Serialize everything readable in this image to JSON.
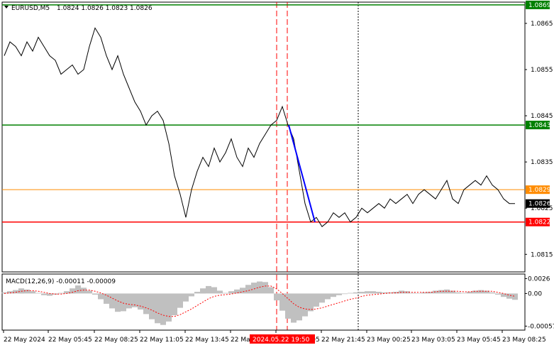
{
  "header": {
    "symbol": "EURUSD,M5",
    "ohlc": "1.0824 1.0826 1.0823 1.0826"
  },
  "colors": {
    "background": "#ffffff",
    "frame": "#000000",
    "price_line": "#000000",
    "green_line": "#008000",
    "orange_line": "#ff8c00",
    "red_line": "#ff0000",
    "trend_line": "#0000ff",
    "macd_hist": "#c0c0c0",
    "signal_line": "#ff0000",
    "vline_red": "#ff0000",
    "vline_black": "#000000",
    "current_price_bg": "#000000",
    "time_highlight_bg": "#ff0000"
  },
  "chart_data": [
    {
      "type": "line",
      "title": "EURUSD,M5",
      "y_ticks": [
        "1.0865",
        "1.0855",
        "1.0845",
        "1.0835",
        "1.0825",
        "1.0815"
      ],
      "ylim": [
        1.08112,
        1.08696
      ],
      "x_labels": [
        "22 May 2024",
        "22 May 05:45",
        "22 May 08:25",
        "22 May 11:05",
        "22 May 13:45",
        "22 May 16:25",
        "22 May 19:05",
        "22 May 21:45",
        "23 May 00:25",
        "23 May 03:05",
        "23 May 05:45",
        "23 May 08:25"
      ],
      "x_highlight_label": "2024.05.22 19:50",
      "horizontal_levels": [
        {
          "price": 1.0869,
          "label": "1.0869",
          "color": "#008000"
        },
        {
          "price": 1.0843,
          "label": "1.0843",
          "color": "#008000"
        },
        {
          "price": 1.0829,
          "label": "1.0829",
          "color": "#ff8c00"
        },
        {
          "price": 1.0822,
          "label": "1.0822",
          "color": "#ff0000"
        }
      ],
      "current_price": "1.0826",
      "trend_line": {
        "from_price": 1.0843,
        "to_price": 1.0822
      },
      "series": [
        {
          "values": [
            1.0858,
            1.0861,
            1.086,
            1.0858,
            1.0861,
            1.0859,
            1.0862,
            1.086,
            1.0858,
            1.0857,
            1.0854,
            1.0855,
            1.0856,
            1.0854,
            1.0855,
            1.086,
            1.0864,
            1.0862,
            1.0858,
            1.0855,
            1.0858,
            1.0854,
            1.0851,
            1.0848,
            1.0846,
            1.0843,
            1.0845,
            1.0846,
            1.0844,
            1.0839,
            1.0832,
            1.0828,
            1.0823,
            1.0829,
            1.0833,
            1.0836,
            1.0834,
            1.0838,
            1.0835,
            1.0837,
            1.084,
            1.0836,
            1.0834,
            1.0838,
            1.0836,
            1.0839,
            1.0841,
            1.0843,
            1.0844,
            1.0847,
            1.0843,
            1.084,
            1.0833,
            1.0826,
            1.0822,
            1.0823,
            1.0821,
            1.0822,
            1.0824,
            1.0823,
            1.0824,
            1.0822,
            1.0823,
            1.0825,
            1.0824,
            1.0825,
            1.0826,
            1.0825,
            1.0827,
            1.0826,
            1.0827,
            1.0828,
            1.0826,
            1.0828,
            1.0829,
            1.0828,
            1.0827,
            1.0829,
            1.0831,
            1.0827,
            1.0826,
            1.0829,
            1.083,
            1.0831,
            1.083,
            1.0832,
            1.083,
            1.0829,
            1.0827,
            1.0826,
            1.0826
          ]
        }
      ]
    },
    {
      "type": "bar",
      "title": "MACD(12,26,9) -0.00011 -0.00009",
      "y_ticks": [
        "0.0026",
        "0.00",
        "-0.00057"
      ],
      "ylim": [
        -0.00064,
        0.00034
      ],
      "series": [
        {
          "name": "MACD",
          "values": [
            2e-05,
            4e-05,
            6e-05,
            9e-05,
            7e-05,
            4e-05,
            1e-05,
            -3e-05,
            -4e-05,
            -2e-05,
            1e-05,
            4e-05,
            9e-05,
            0.00014,
            0.0001,
            5e-05,
            -2e-05,
            -0.0001,
            -0.00018,
            -0.00026,
            -0.00032,
            -0.00031,
            -0.00026,
            -0.00024,
            -0.00028,
            -0.00036,
            -0.00045,
            -0.00052,
            -0.00055,
            -0.00049,
            -0.00038,
            -0.00025,
            -0.00014,
            -5e-05,
            3e-05,
            9e-05,
            0.00013,
            0.00011,
            5e-05,
            1e-05,
            4e-05,
            7e-05,
            0.0001,
            0.00015,
            0.00019,
            0.00021,
            0.0002,
            0.00011,
            -0.00012,
            -0.0003,
            -0.00044,
            -0.00051,
            -0.00047,
            -0.0004,
            -0.00031,
            -0.00023,
            -0.00016,
            -0.0001,
            -6e-05,
            -3e-05,
            -1e-05,
            1e-05,
            2e-05,
            3e-05,
            4e-05,
            4e-05,
            3e-05,
            2e-05,
            2e-05,
            3e-05,
            5e-05,
            4e-05,
            1e-05,
            0.0,
            2e-05,
            3e-05,
            5e-05,
            6e-05,
            7e-05,
            5e-05,
            2e-05,
            1e-05,
            3e-05,
            5e-05,
            6e-05,
            5e-05,
            2e-05,
            -2e-05,
            -6e-05,
            -9e-05,
            -0.00011
          ]
        },
        {
          "name": "Signal",
          "values": [
            0.0,
            1e-05,
            2e-05,
            4e-05,
            5e-05,
            5e-05,
            4e-05,
            2e-05,
            0.0,
            -1e-05,
            -1e-05,
            0.0,
            2e-05,
            5e-05,
            6e-05,
            6e-05,
            4e-05,
            1e-05,
            -3e-05,
            -8e-05,
            -0.00013,
            -0.00017,
            -0.00019,
            -0.0002,
            -0.00022,
            -0.00025,
            -0.00029,
            -0.00034,
            -0.00038,
            -0.0004,
            -0.0004,
            -0.00037,
            -0.00032,
            -0.00027,
            -0.00021,
            -0.00015,
            -9e-05,
            -5e-05,
            -3e-05,
            -2e-05,
            -1e-05,
            1e-05,
            3e-05,
            5e-05,
            8e-05,
            0.00011,
            0.00013,
            0.00013,
            8e-05,
            0.0,
            -9e-05,
            -0.00018,
            -0.00024,
            -0.00027,
            -0.00028,
            -0.00027,
            -0.00025,
            -0.00022,
            -0.00019,
            -0.00016,
            -0.00013,
            -0.0001,
            -8e-05,
            -5e-05,
            -3e-05,
            -2e-05,
            -1e-05,
            0.0,
            1e-05,
            1e-05,
            2e-05,
            2e-05,
            2e-05,
            2e-05,
            2e-05,
            2e-05,
            3e-05,
            4e-05,
            4e-05,
            4e-05,
            4e-05,
            3e-05,
            3e-05,
            4e-05,
            4e-05,
            4e-05,
            4e-05,
            2e-05,
            0.0,
            -3e-05,
            -5e-05
          ]
        }
      ]
    }
  ]
}
